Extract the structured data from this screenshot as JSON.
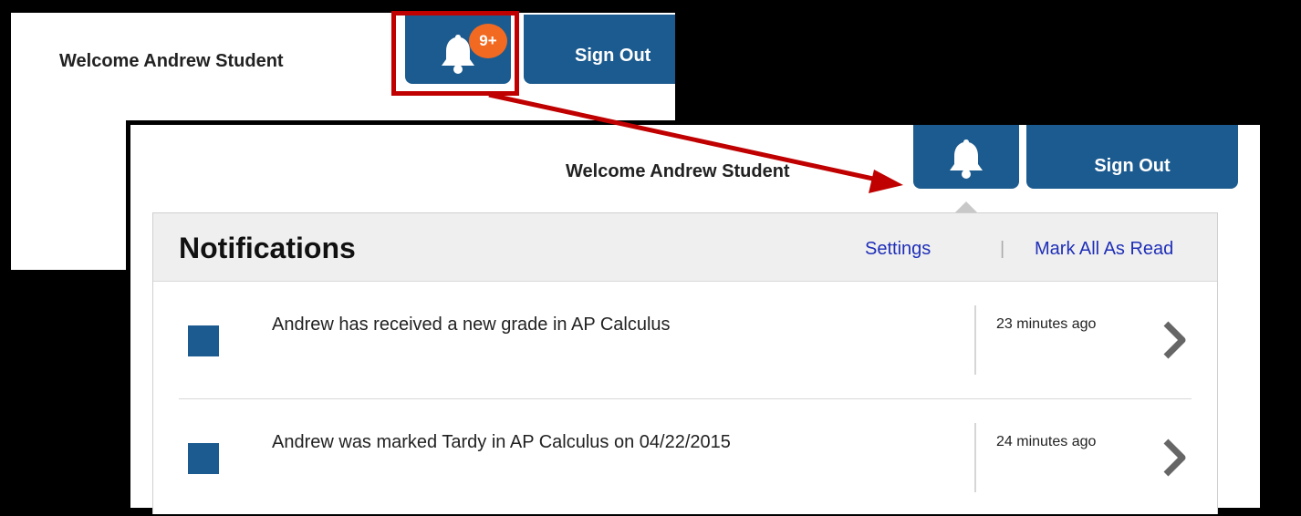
{
  "top_screen": {
    "welcome_text": "Welcome Andrew Student",
    "badge_count": "9+",
    "signout_label": "Sign Out"
  },
  "main_screen": {
    "welcome_text": "Welcome Andrew Student",
    "signout_label": "Sign Out",
    "notifications": {
      "title": "Notifications",
      "settings_label": "Settings",
      "separator": "|",
      "mark_all_label": "Mark All As Read",
      "items": [
        {
          "message": "Andrew has received a new grade in AP Calculus",
          "time": "23 minutes ago",
          "icon": "chevron-right-icon"
        },
        {
          "message": "Andrew was marked Tardy in AP Calculus on 04/22/2015",
          "time": "24 minutes ago",
          "icon": "chevron-right-icon"
        }
      ]
    }
  },
  "colors": {
    "button_blue": "#1c5b8f",
    "badge_orange": "#f26a21",
    "highlight_red": "#c00000",
    "link_blue": "#1f2fb8"
  },
  "icons": [
    "bell-icon",
    "chevron-right-icon",
    "unread-indicator-icon"
  ]
}
